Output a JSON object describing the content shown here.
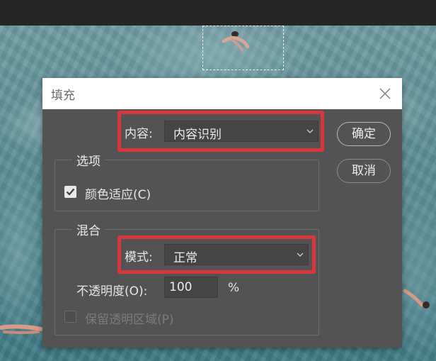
{
  "dialog": {
    "title": "填充",
    "content_label": "内容:",
    "content_value": "内容识别",
    "ok_label": "确定",
    "cancel_label": "取消",
    "options_group_title": "选项",
    "color_adapt_label": "颜色适应(C)",
    "color_adapt_checked": true,
    "blend_group_title": "混合",
    "mode_label": "模式:",
    "mode_value": "正常",
    "opacity_label": "不透明度(O):",
    "opacity_value": "100",
    "opacity_unit": "%",
    "preserve_transparency_label": "保留透明区域(P)",
    "preserve_transparency_checked": false,
    "preserve_transparency_enabled": false
  },
  "colors": {
    "dialog_bg": "#535353",
    "highlight": "#d8363d",
    "titlebar_bg": "#ffffff"
  },
  "icons": {
    "close": "close-icon",
    "dropdown": "chevron-down-icon",
    "check": "checkmark-icon"
  }
}
